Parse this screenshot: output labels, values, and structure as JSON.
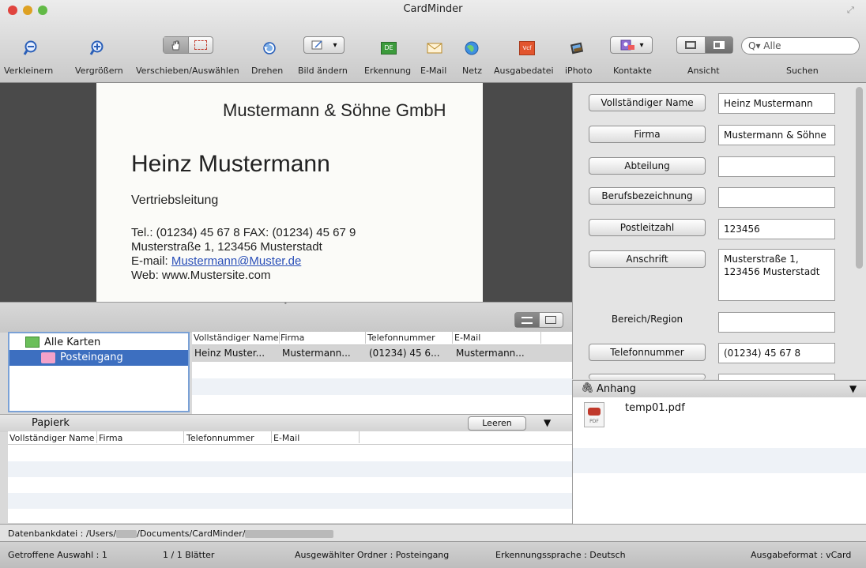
{
  "window": {
    "title": "CardMinder"
  },
  "toolbar": {
    "zoom_out": "Verkleinern",
    "zoom_in": "Vergrößern",
    "move_select": "Verschieben/Auswählen",
    "rotate": "Drehen",
    "change_image": "Bild ändern",
    "recognition": "Erkennung",
    "recognition_badge": "DE",
    "email": "E-Mail",
    "net": "Netz",
    "output_file": "Ausgabedatei",
    "output_badge": "Vcf",
    "iphoto": "iPhoto",
    "contacts": "Kontakte",
    "view": "Ansicht",
    "search": "Suchen",
    "search_value": "Alle"
  },
  "card": {
    "company": "Mustermann & Söhne GmbH",
    "name": "Heinz Mustermann",
    "role": "Vertriebsleitung",
    "phone_line": "Tel.: (01234) 45 67 8 FAX: (01234) 45 67 9",
    "address_line": "Musterstraße 1, 123456 Musterstadt",
    "email_prefix": "E-mail: ",
    "email": "Mustermann@Muster.de",
    "web_line": "Web: www.Mustersite.com"
  },
  "form": {
    "full_name_label": "Vollständiger Name",
    "full_name_value": "Heinz Mustermann",
    "company_label": "Firma",
    "company_value": "Mustermann & Söhne",
    "department_label": "Abteilung",
    "department_value": "",
    "job_title_label": "Berufsbezeichnung",
    "job_title_value": "",
    "postcode_label": "Postleitzahl",
    "postcode_value": "123456",
    "address_label": "Anschrift",
    "address_value_1": "Musterstraße 1,",
    "address_value_2": "123456 Musterstadt",
    "region_label": "Bereich/Region",
    "region_value": "",
    "phone_label": "Telefonnummer",
    "phone_value": "(01234) 45 67 8"
  },
  "folders": {
    "root": "Alle Karten",
    "inbox": "Posteingang"
  },
  "card_list": {
    "headers": [
      "Vollständiger Name",
      "Firma",
      "Telefonnummer",
      "E-Mail"
    ],
    "rows": [
      [
        "Heinz Muster...",
        "Mustermann...",
        "(01234) 45 6...",
        "Mustermann..."
      ]
    ]
  },
  "trash": {
    "title": "Papierk",
    "empty_button": "Leeren",
    "headers": [
      "Vollständiger Name",
      "Firma",
      "Telefonnummer",
      "E-Mail"
    ]
  },
  "attachment": {
    "title": "Anhang",
    "file_name": "temp01.pdf",
    "file_type": "PDF"
  },
  "db_bar": {
    "prefix": "Datenbankdatei : /Users/",
    "middle": "/Documents/CardMinder/"
  },
  "status": {
    "hits": "Getroffene Auswahl : 1",
    "sheets": "1 / 1 Blätter",
    "folder": "Ausgewählter Ordner : Posteingang",
    "language": "Erkennungssprache : Deutsch",
    "format": "Ausgabeformat : vCard"
  },
  "colors": {
    "selection": "#3d6fc0",
    "close": "#e0443e",
    "minimize": "#dea123",
    "zoom": "#62ba46",
    "folder_pink": "#f3a2c9"
  }
}
